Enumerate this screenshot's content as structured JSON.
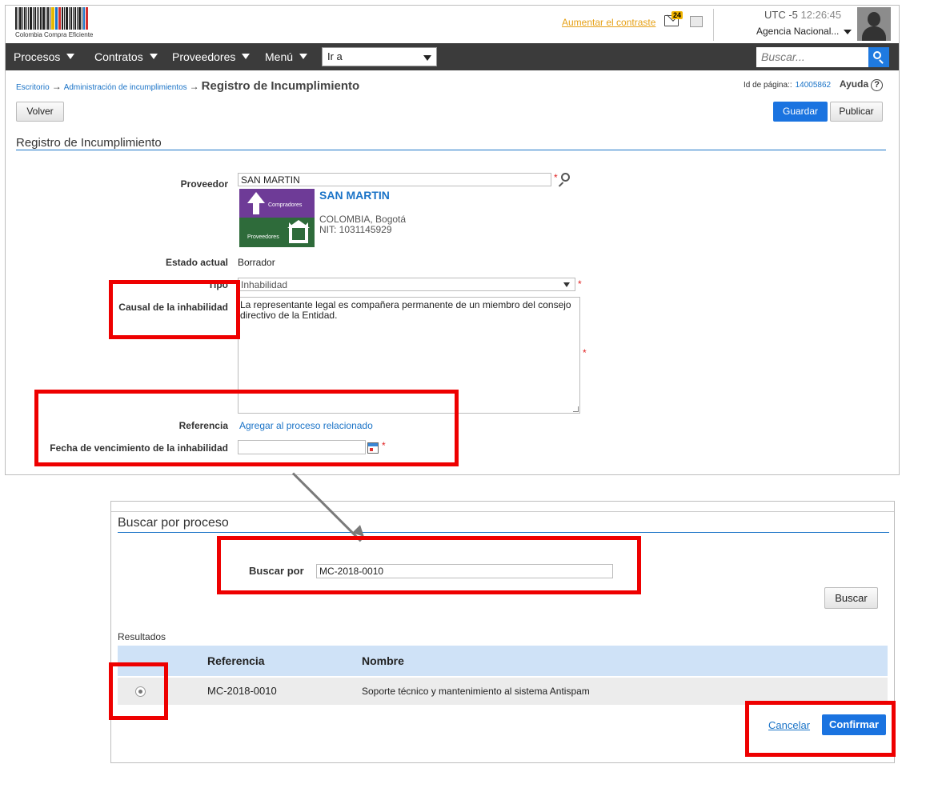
{
  "header": {
    "logo_text": "Colombia Compra Eficiente",
    "contrast_link": "Aumentar el contraste",
    "mail_badge": "24",
    "timezone": "UTC -5",
    "time": "12:26:45",
    "agency": "Agencia Nacional..."
  },
  "nav": {
    "items": [
      {
        "label": "Procesos"
      },
      {
        "label": "Contratos"
      },
      {
        "label": "Proveedores"
      },
      {
        "label": "Menú"
      }
    ],
    "goto_value": "Ir a",
    "search_placeholder": "Buscar..."
  },
  "breadcrumb": {
    "items": [
      "Escritorio",
      "Administración de incumplimientos"
    ],
    "current": "Registro de Incumplimiento"
  },
  "page_info": {
    "id_label": "Id de página::",
    "id_value": "14005862",
    "help_label": "Ayuda",
    "help_icon": "?"
  },
  "toolbar": {
    "back_label": "Volver",
    "save_label": "Guardar",
    "publish_label": "Publicar"
  },
  "form": {
    "section_title": "Registro de Incumplimiento",
    "supplier_label": "Proveedor",
    "supplier_value": "SAN MARTIN",
    "supplier_name": "SAN MARTIN",
    "supplier_location": "COLOMBIA, Bogotá",
    "supplier_nit": "NIT: 1031145929",
    "logo_top_text": "Compradores",
    "logo_bottom_text": "Proveedores",
    "state_label": "Estado actual",
    "state_value": "Borrador",
    "type_label": "Tipo",
    "type_value": "Inhabilidad",
    "cause_label": "Causal de la inhabilidad",
    "cause_value": "La representante legal es compañera permanente de un miembro del consejo directivo de la Entidad.",
    "reference_label": "Referencia",
    "reference_link": "Agregar al proceso relacionado",
    "expiry_label": "Fecha de vencimiento de la inhabilidad",
    "expiry_value": "",
    "required_mark": "*"
  },
  "search_dialog": {
    "title": "Buscar por proceso",
    "search_by_label": "Buscar por",
    "search_by_value": "MC-2018-0010",
    "search_button": "Buscar",
    "results_label": "Resultados",
    "columns": [
      "Referencia",
      "Nombre"
    ],
    "rows": [
      {
        "selected": true,
        "reference": "MC-2018-0010",
        "name": "Soporte técnico y mantenimiento al sistema Antispam"
      }
    ],
    "cancel_label": "Cancelar",
    "confirm_label": "Confirmar"
  },
  "colors": {
    "accent": "#1a73e0",
    "nav_bg": "#3b3b3b",
    "highlight": "#ee0000",
    "link": "#1a73c7"
  }
}
